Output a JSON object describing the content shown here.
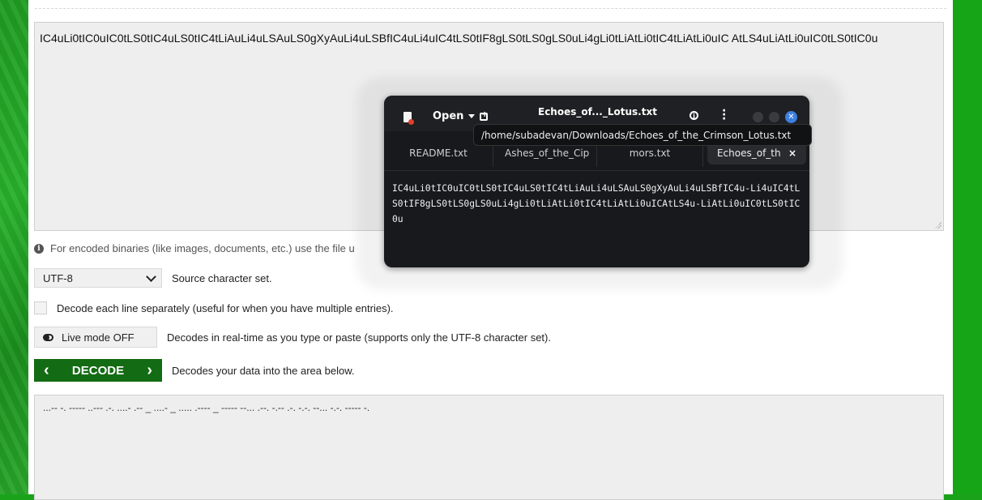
{
  "input": {
    "value": "IC4uLi0tIC0uIC0tLS0tIC4uLS0tIC4tLiAuLi4uLSAuLS0gXyAuLi4uLSBfIC4uLi4uIC4tLS0tIF8gLS0tLS0gLS0uLi4gLi0tLiAtLi0tIC4tLiAtLi0uIC AtLS4uLiAtLi0uIC0tLS0tIC0u"
  },
  "info_text": "For encoded binaries (like images, documents, etc.) use the file u",
  "charset": {
    "selected": "UTF-8",
    "label": "Source character set."
  },
  "decode_lines": {
    "label": "Decode each line separately (useful for when you have multiple entries)."
  },
  "live_mode": {
    "button": "Live mode OFF",
    "label": "Decodes in real-time as you type or paste (supports only the UTF-8 character set)."
  },
  "decode": {
    "button": "DECODE",
    "label": "Decodes your data into the area below."
  },
  "output": {
    "value": "...-- -. ----- ..--- .-. ....- .-- _ ....- _ ..... .---- _ ----- --... .--. -.-- .-. -.-.  --... -.-. ----- -."
  },
  "editor": {
    "title": "Echoes_of..._Lotus.txt",
    "open_label": "Open",
    "tooltip": "/home/subadevan/Downloads/Echoes_of_the_Crimson_Lotus.txt",
    "tabs": [
      "README.txt",
      "Ashes_of_the_Cip",
      "mors.txt",
      "Echoes_of_the"
    ],
    "content": "IC4uLi0tIC0uIC0tLS0tIC4uLS0tIC4tLiAuLi4uLSAuLS0gXyAuLi4uLSBfIC4u-Li4uIC4tLS0tIF8gLS0tLS0gLS0uLi4gLi0tLiAtLi0tIC4tLiAtLi0uICAtLS4u-LiAtLi0uIC0tLS0tIC0u"
  },
  "colors": {
    "accent_green": "#136b13",
    "border_green": "#16a516",
    "editor_bg": "#18191c",
    "close_button": "#3c7fe0"
  }
}
